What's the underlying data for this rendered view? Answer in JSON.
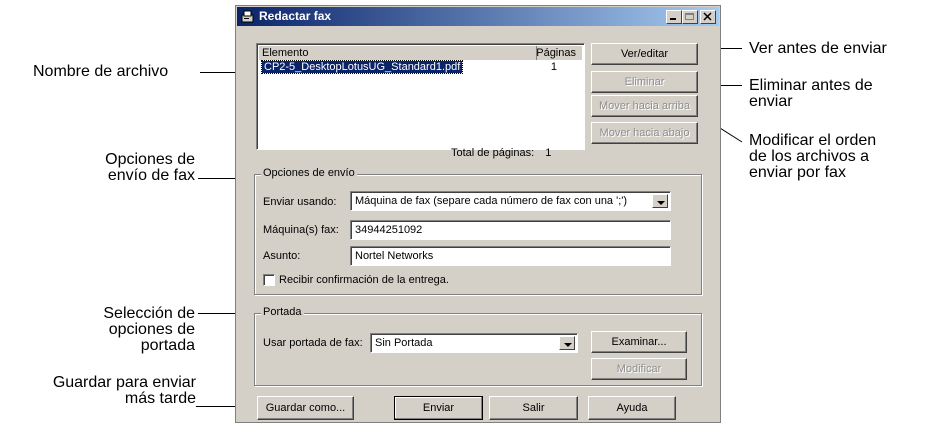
{
  "callouts": {
    "nombre_archivo": "Nombre de archivo",
    "opciones_envio_l1": "Opciones de",
    "opciones_envio_l2": "envío de fax",
    "seleccion_portada_l1": "Selección de",
    "seleccion_portada_l2": "opciones de",
    "seleccion_portada_l3": "portada",
    "guardar_l1": "Guardar para enviar",
    "guardar_l2": "más tarde",
    "ver_antes": "Ver antes de enviar",
    "eliminar_l1": "Eliminar antes de",
    "eliminar_l2": "enviar",
    "modificar_l1": "Modificar el orden",
    "modificar_l2": "de los archivos a",
    "modificar_l3": "enviar por fax"
  },
  "window": {
    "title": "Redactar fax"
  },
  "file_list": {
    "col_elemento": "Elemento",
    "col_paginas": "Páginas",
    "rows": [
      {
        "name": "CP2-5_DesktopLotusUG_Standard1.pdf",
        "pages": "1"
      }
    ],
    "total_label": "Total de páginas:",
    "total_value": "1"
  },
  "buttons": {
    "ver_editar": "Ver/editar",
    "eliminar": "Eliminar",
    "mover_arriba": "Mover hacia arriba",
    "mover_abajo": "Mover hacia abajo",
    "examinar": "Examinar...",
    "modificar": "Modificar",
    "guardar_como": "Guardar como...",
    "enviar": "Enviar",
    "salir": "Salir",
    "ayuda": "Ayuda"
  },
  "opciones_envio": {
    "legend": "Opciones de envío",
    "enviar_usando_label": "Enviar usando:",
    "enviar_usando_value": "Máquina de fax (separe cada número de fax con una ';')",
    "maquinas_label": "Máquina(s) fax:",
    "maquinas_value": "34944251092",
    "asunto_label": "Asunto:",
    "asunto_value": "Nortel Networks",
    "confirmacion_label": "Recibir confirmación de la entrega.",
    "confirmacion_checked": false
  },
  "portada": {
    "legend": "Portada",
    "usar_label": "Usar portada de fax:",
    "usar_value": "Sin Portada"
  }
}
